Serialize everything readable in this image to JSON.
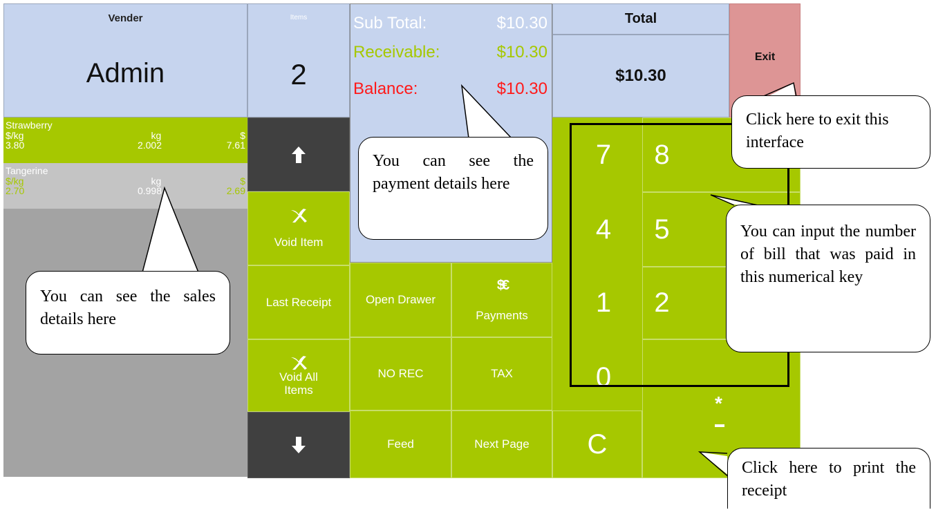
{
  "vendor": {
    "label": "Vender",
    "name": "Admin"
  },
  "items": {
    "label": "Items",
    "count": "2"
  },
  "payment": {
    "subtotal_label": "Sub Total:",
    "subtotal_value": "$10.30",
    "receivable_label": "Receivable:",
    "receivable_value": "$10.30",
    "balance_label": "Balance:",
    "balance_value": "$10.30"
  },
  "total": {
    "label": "Total",
    "value": "$10.30"
  },
  "exit_label": "Exit",
  "sales": [
    {
      "name": "Strawberry",
      "h_price": "$/kg",
      "h_weight": "kg",
      "h_amount": "$",
      "price": "3.80",
      "weight": "2.002",
      "amount": "7.61",
      "selected": true
    },
    {
      "name": "Tangerine",
      "h_price": "$/kg",
      "h_weight": "kg",
      "h_amount": "$",
      "price": "2.70",
      "weight": "0.998",
      "amount": "2.69",
      "selected": false
    }
  ],
  "buttons": {
    "up_icon": "arrow-up-icon",
    "void_item": "Void Item",
    "last_receipt": "Last Receipt",
    "void_all": "Void All Items",
    "down_icon": "arrow-down-icon",
    "open_drawer": "Open Drawer",
    "payments": "Payments",
    "payments_icon": "$€",
    "no_rec": "NO REC",
    "tax": "TAX",
    "feed": "Feed",
    "next_page": "Next Page",
    "clear": "C",
    "print_symbol": "*"
  },
  "keypad": {
    "k7": "7",
    "k8": "8",
    "k4": "4",
    "k5": "5",
    "k1": "1",
    "k2": "2",
    "k0": "0"
  },
  "callouts": {
    "sales": "You can see the sales details here",
    "payment": "You can see the payment details here",
    "exit": "Click here to exit this interface",
    "keypad": "You can input the number of bill that was paid in this numerical key",
    "print": "Click here to print the receipt"
  },
  "colors": {
    "green": "#a6c800",
    "panel_blue": "#c6d4ee",
    "exit_red": "#dd9595",
    "balance_red": "#ff1a1a",
    "dark_button": "#404040"
  }
}
